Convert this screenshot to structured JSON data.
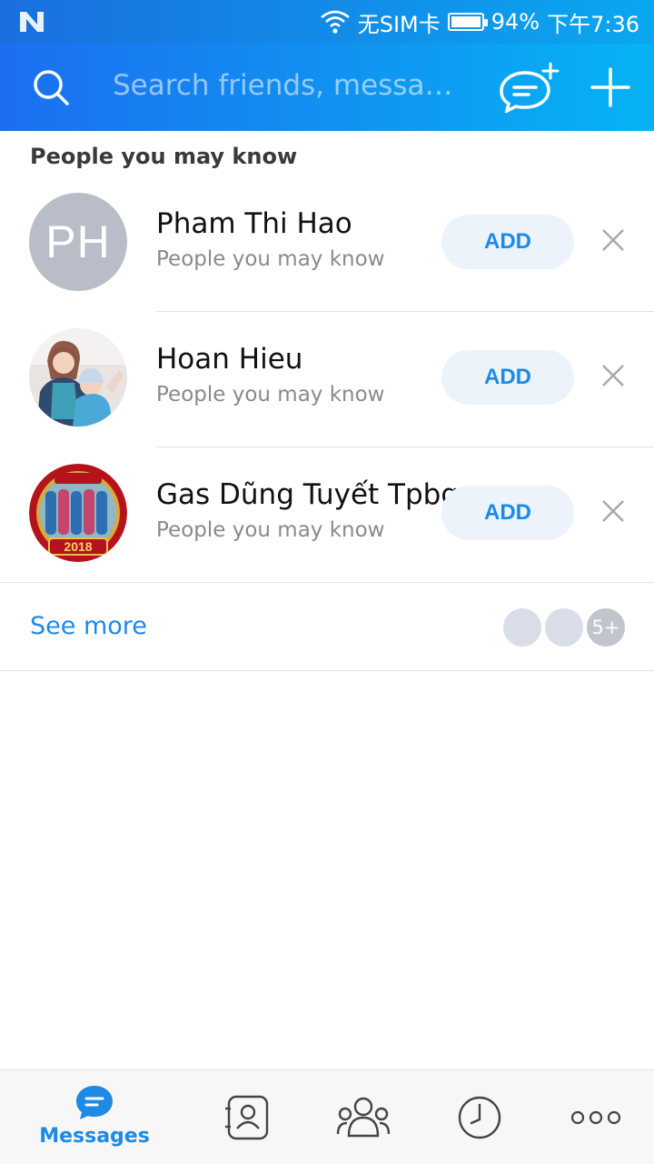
{
  "status_bar": {
    "logo_icon": "n-logo-icon",
    "carrier": "无SIM卡",
    "battery": "94%",
    "time": "下午7:36"
  },
  "top_bar": {
    "search_placeholder": "Search friends, messages…",
    "icons": [
      "search-icon",
      "new-chat-icon",
      "plus-icon"
    ]
  },
  "section": {
    "title": "People you may know"
  },
  "people": [
    {
      "name": "Pham Thi Hao",
      "subtitle": "People you may know",
      "initials": "PH",
      "add_label": "ADD"
    },
    {
      "name": "Hoan Hieu",
      "subtitle": "People you may know",
      "add_label": "ADD"
    },
    {
      "name": "Gas Dũng Tuyết Tpbg",
      "subtitle": "People you may know",
      "add_label": "ADD",
      "badge_year": "2018"
    }
  ],
  "see_more": {
    "label": "See more",
    "more_count": "5+"
  },
  "bottom_nav": {
    "messages_label": "Messages"
  },
  "colors": {
    "accent": "#1d8ae6",
    "header_start": "#1c6ff0",
    "header_end": "#06b3f4",
    "avatar_gray": "#b9bdc8"
  }
}
